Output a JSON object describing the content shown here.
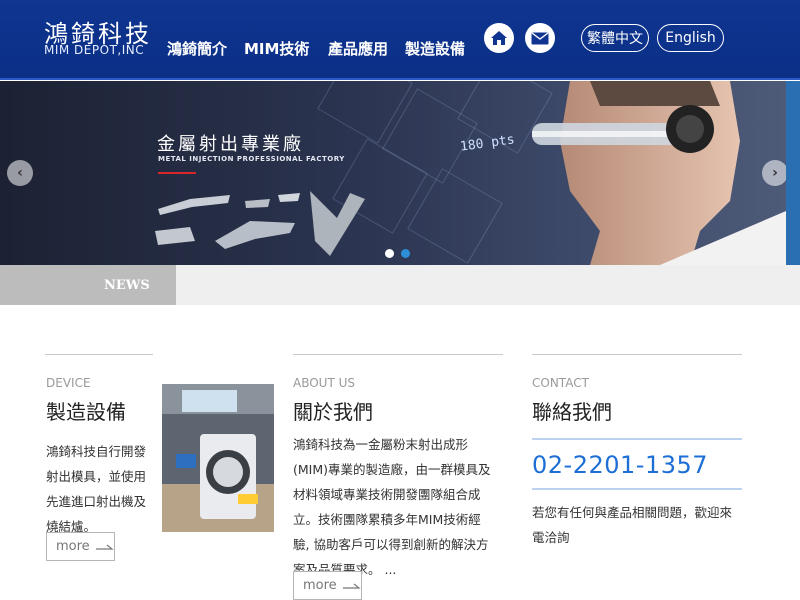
{
  "header": {
    "logo_cn": "鴻錡科技",
    "logo_en": "MIM DEPOT,INC",
    "nav": [
      "鴻錡簡介",
      "MIM技術",
      "產品應用",
      "製造設備"
    ],
    "lang_zh": "繁體中文",
    "lang_en": "English"
  },
  "banner": {
    "title": "金屬射出專業廠",
    "subtitle": "METAL INJECTION PROFESSIONAL FACTORY",
    "overlay_text": "180 pts",
    "slides_total": 2,
    "active_slide": 2
  },
  "news": {
    "tab_label": "NEWS"
  },
  "device": {
    "label": "DEVICE",
    "title": "製造設備",
    "lines": [
      "鴻錡科技自行開發",
      "射出模具，並使用",
      "先進進口射出機及",
      "燒結爐。"
    ],
    "more": "more"
  },
  "about": {
    "label": "ABOUT US",
    "title": "關於我們",
    "lines": [
      "鴻錡科技為一金屬粉末射出成形",
      "(MIM)專業的製造廠，由一群模具及",
      "材料領域專業技術開發團隊組合成",
      "立。技術團隊累積多年MIM技術經",
      "驗, 協助客戶可以得到創新的解決方",
      "案及品質要求。 ..."
    ],
    "more": "more"
  },
  "contact": {
    "label": "CONTACT",
    "title": "聯絡我們",
    "phone": "02-2201-1357",
    "lines": [
      "若您有任何與產品相關問題，歡迎來",
      "電洽詢"
    ]
  },
  "colors": {
    "header_bg": "#0f3591",
    "phone": "#1d6fd6",
    "accent_red": "#d8262c",
    "dot_active": "#2d8fd6"
  },
  "icons": [
    "home-icon",
    "mail-icon",
    "chevron-left-icon",
    "chevron-right-icon",
    "arrow-right-icon"
  ]
}
